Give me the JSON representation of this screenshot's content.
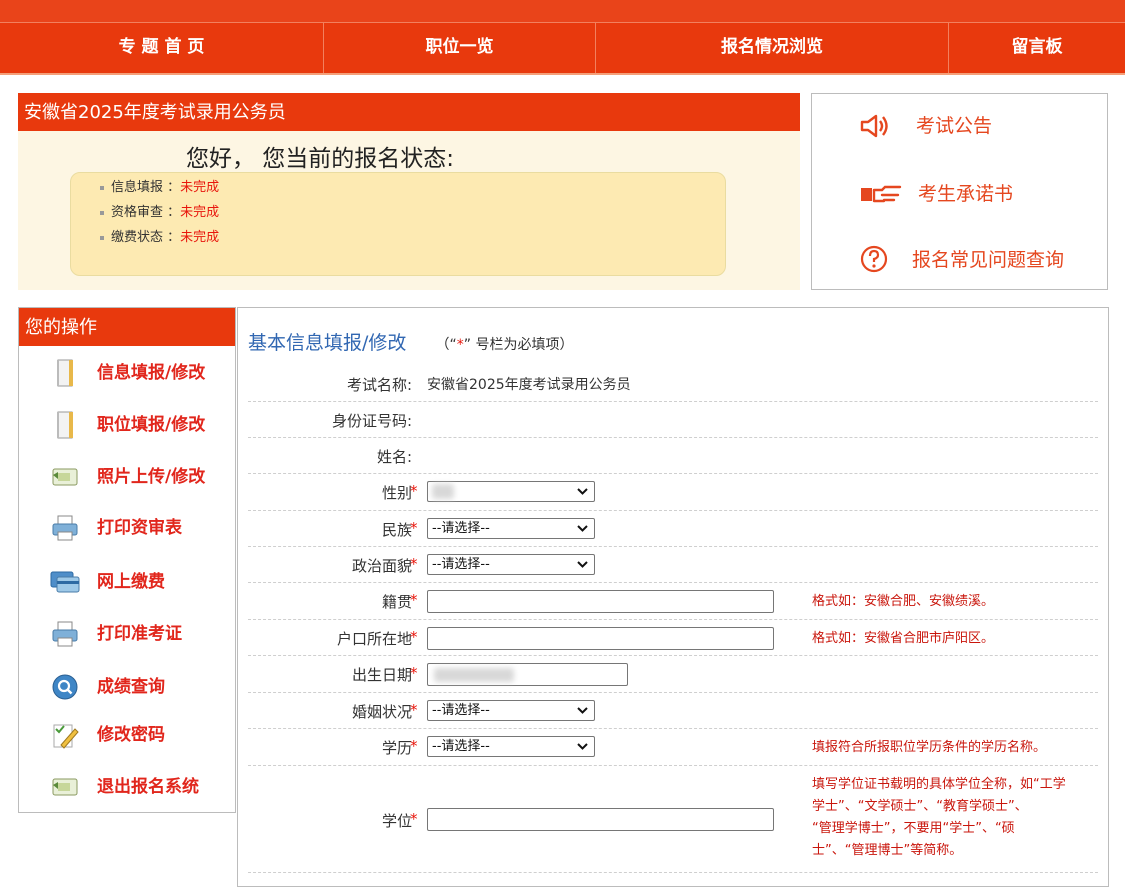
{
  "nav": {
    "items": [
      "专 题 首 页",
      "职位一览",
      "报名情况浏览",
      "留言板"
    ]
  },
  "status": {
    "title": "安徽省2025年度考试录用公务员",
    "greeting": "您好， 您当前的报名状态:",
    "items": [
      {
        "label": "信息填报 ：",
        "value": "未完成"
      },
      {
        "label": "资格审查 ：",
        "value": "未完成"
      },
      {
        "label": "缴费状态 ：",
        "value": "未完成"
      }
    ]
  },
  "quick_links": {
    "notice": "考试公告",
    "pledge": "考生承诺书",
    "faq": "报名常见问题查询"
  },
  "sidebar": {
    "title": "您的操作",
    "items": [
      "信息填报/修改",
      "职位填报/修改",
      "照片上传/修改",
      "打印资审表",
      "网上缴费",
      "打印准考证",
      "成绩查询",
      "修改密码",
      "退出报名系统"
    ]
  },
  "form": {
    "heading": "基本信息填报/修改",
    "note_pre": "（“",
    "note_star": "*",
    "note_post": "” 号栏为必填项）",
    "exam_name_label": "考试名称:",
    "exam_name_value": "安徽省2025年度考试录用公务员",
    "id_label": "身份证号码:",
    "name_label": "姓名:",
    "gender_label": "性别",
    "ethnic_label": "民族",
    "ethnic_value": "--请选择--",
    "political_label": "政治面貌",
    "political_value": "--请选择--",
    "native_label": "籍贯",
    "native_hint": "格式如：安徽合肥、安徽绩溪。",
    "hukou_label": "户口所在地",
    "hukou_hint": "格式如：安徽省合肥市庐阳区。",
    "birth_label": "出生日期",
    "marital_label": "婚姻状况",
    "marital_value": "--请选择--",
    "edu_label": "学历",
    "edu_value": "--请选择--",
    "edu_hint": "填报符合所报职位学历条件的学历名称。",
    "degree_label": "学位",
    "degree_hint": [
      "填写学位证书载明的具体学位全称，如“工学",
      "学士”、“文学硕士”、“教育学硕士”、",
      "“管理学博士”，不要用“学士”、“硕",
      "士”、“管理博士”等简称。"
    ],
    "required_mark": "*"
  }
}
